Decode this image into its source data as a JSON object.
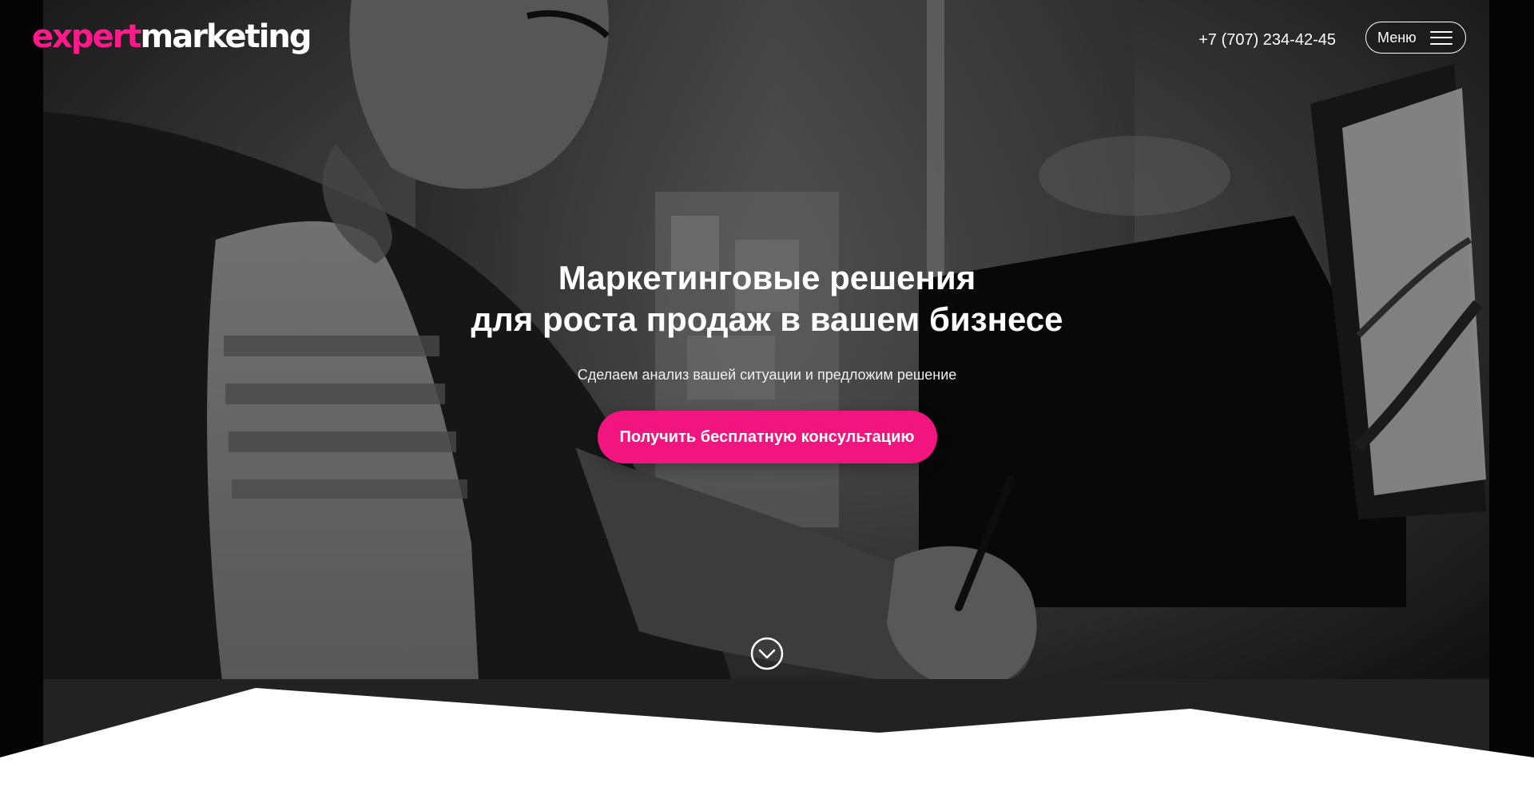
{
  "header": {
    "logo": {
      "part1": "expert",
      "part2": "marketing"
    },
    "phone": "+7 (707) 234-42-45",
    "menu_label": "Меню"
  },
  "hero": {
    "title_line1": "Маркетинговые решения",
    "title_line2": "для роста продаж в вашем бизнесе",
    "subtitle": "Сделаем анализ вашей ситуации и предложим решение",
    "cta_label": "Получить бесплатную консультацию"
  },
  "icons": {
    "menu": "hamburger-icon",
    "scroll": "chevron-down-circle-icon"
  },
  "colors": {
    "accent": "#f2157f",
    "logo_accent": "#ff1a8c",
    "text": "#ffffff"
  }
}
